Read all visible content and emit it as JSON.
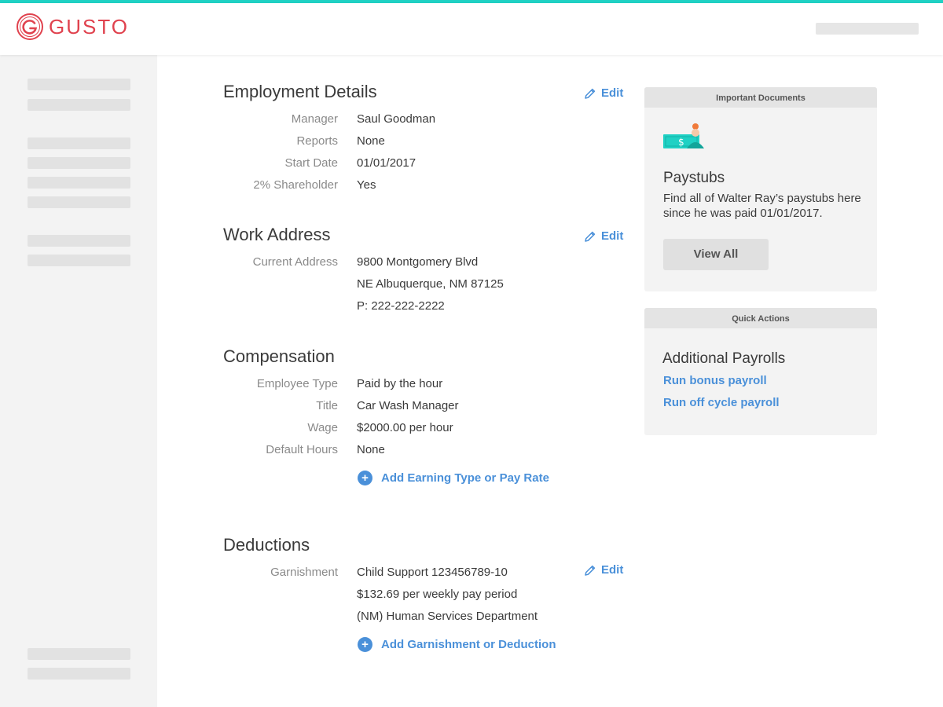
{
  "brand": {
    "name": "GUSTO",
    "color": "#e0424e",
    "accent": "#1fd1c4",
    "link_color": "#4a90d9"
  },
  "employment": {
    "title": "Employment Details",
    "edit": "Edit",
    "rows": [
      {
        "label": "Manager",
        "value": "Saul Goodman"
      },
      {
        "label": "Reports",
        "value": "None"
      },
      {
        "label": "Start Date",
        "value": "01/01/2017"
      },
      {
        "label": "2% Shareholder",
        "value": "Yes"
      }
    ]
  },
  "work_address": {
    "title": "Work Address",
    "edit": "Edit",
    "label": "Current Address",
    "lines": [
      "9800 Montgomery Blvd",
      "NE Albuquerque, NM 87125",
      "P: 222-222-2222"
    ]
  },
  "compensation": {
    "title": "Compensation",
    "rows": [
      {
        "label": "Employee Type",
        "value": "Paid by the hour"
      },
      {
        "label": "Title",
        "value": "Car Wash Manager"
      },
      {
        "label": "Wage",
        "value": "$2000.00 per hour"
      },
      {
        "label": "Default Hours",
        "value": "None"
      }
    ],
    "add_link": "Add Earning Type or Pay Rate"
  },
  "deductions": {
    "title": "Deductions",
    "edit": "Edit",
    "label": "Garnishment",
    "lines": [
      "Child Support 123456789-10",
      "$132.69 per weekly pay period",
      "(NM) Human Services Department"
    ],
    "add_link": "Add Garnishment or Deduction"
  },
  "documents_card": {
    "header": "Important Documents",
    "icon": "paystub-icon",
    "title": "Paystubs",
    "text": "Find all of Walter Ray’s paystubs here since he was paid 01/01/2017.",
    "button": "View All"
  },
  "quick_actions": {
    "header": "Quick Actions",
    "title": "Additional Payrolls",
    "links": [
      "Run bonus payroll",
      "Run off cycle payroll"
    ]
  }
}
